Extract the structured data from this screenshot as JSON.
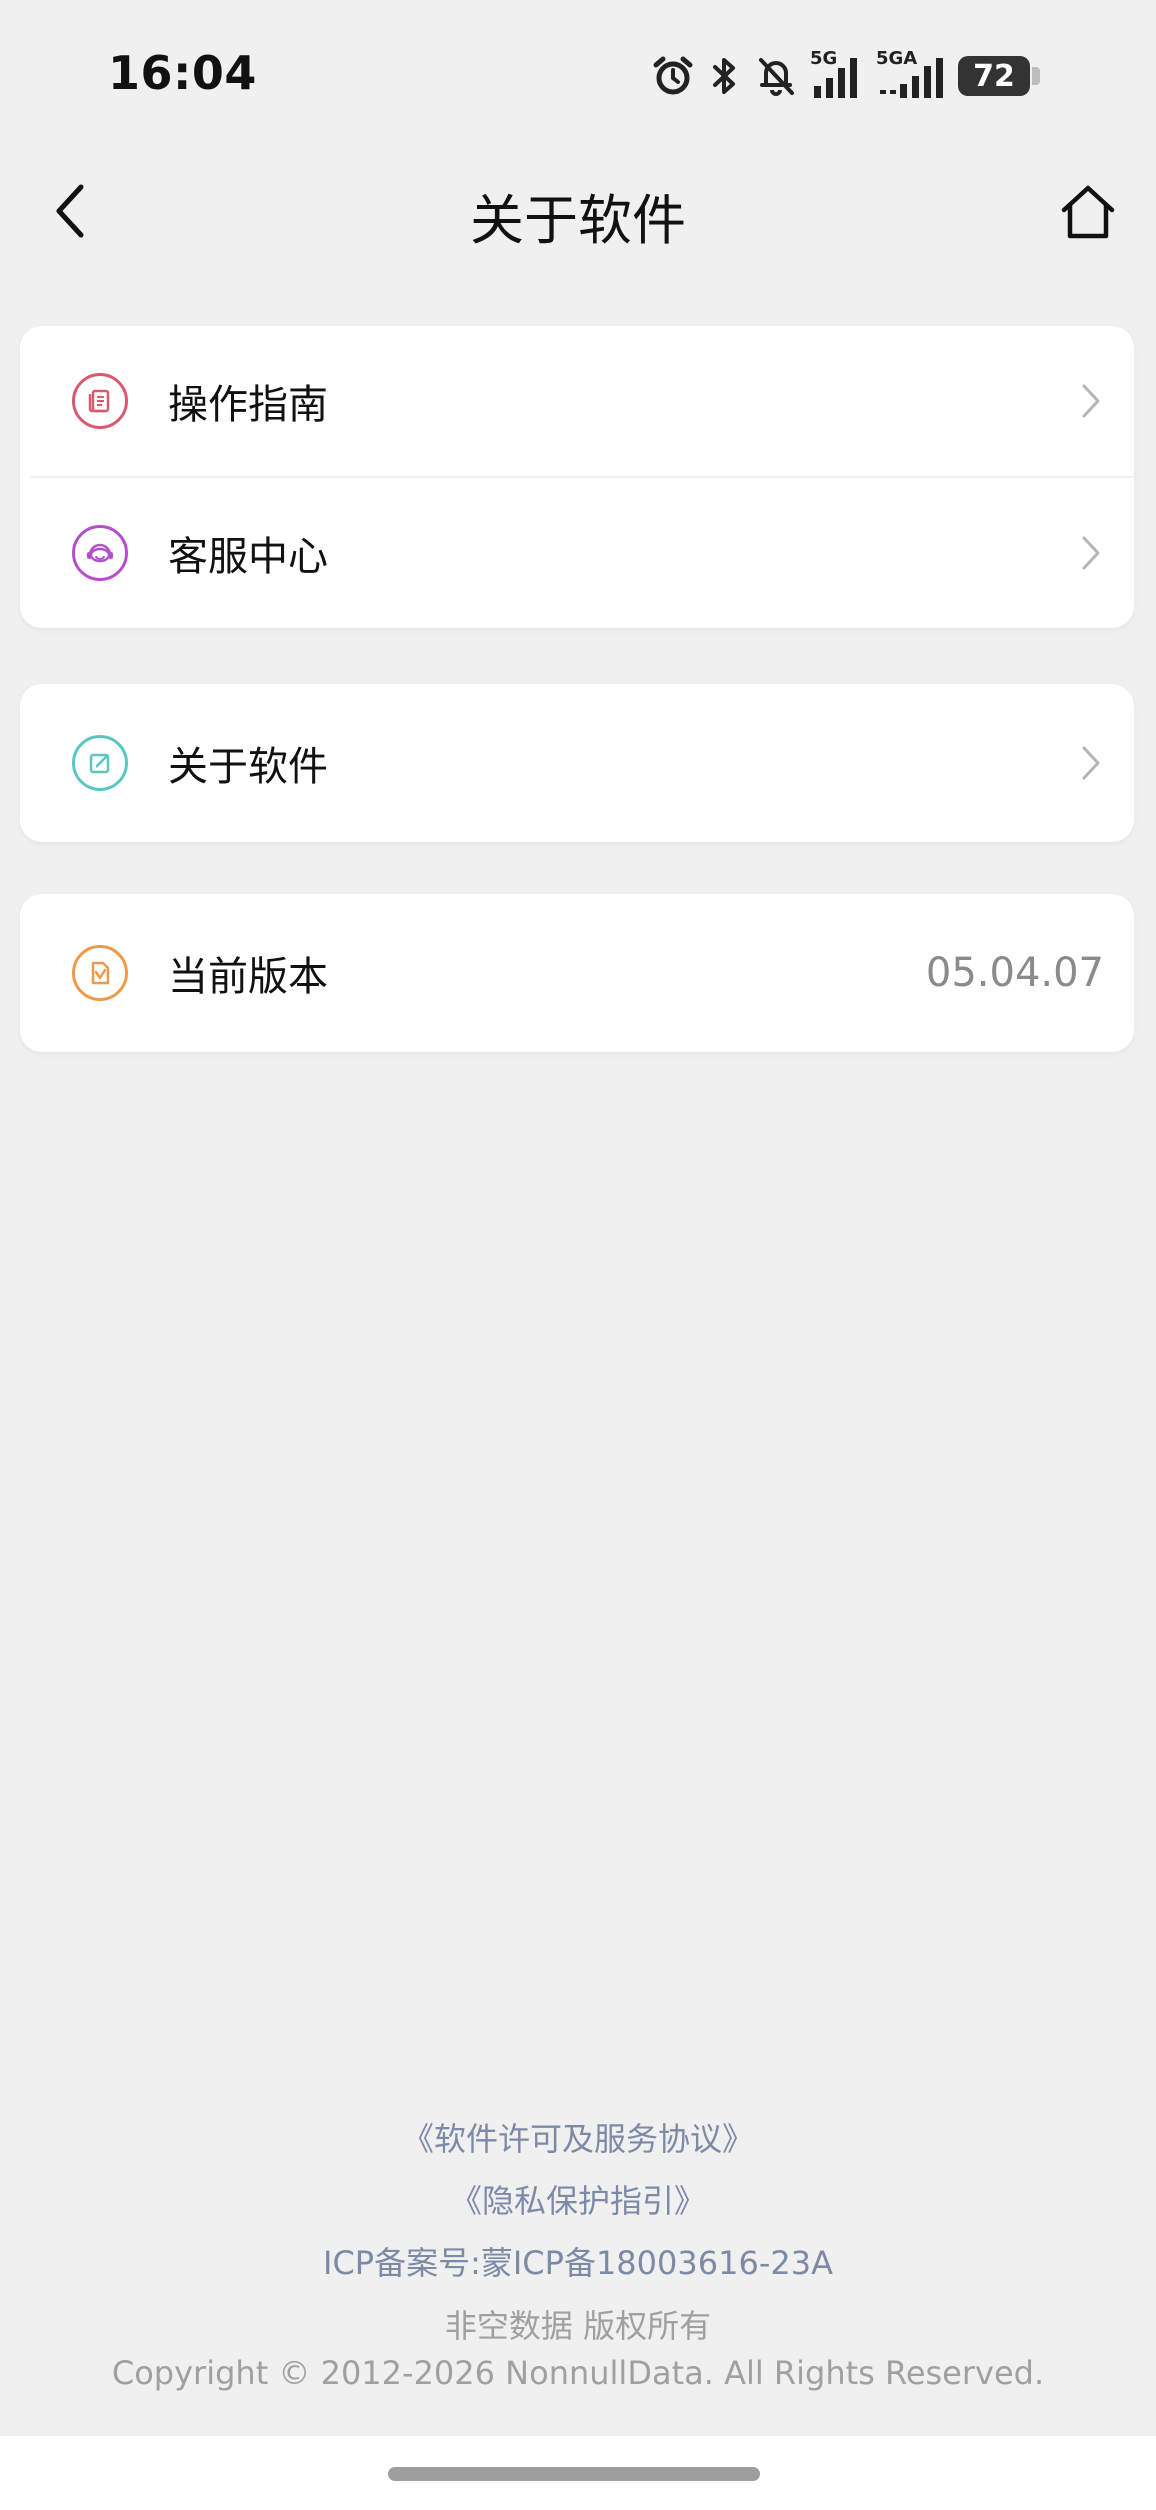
{
  "status_bar": {
    "time": "16:04",
    "network_1": "5G",
    "network_2": "5GA",
    "battery": "72"
  },
  "header": {
    "title": "关于软件"
  },
  "menu": {
    "group1": [
      {
        "label": "操作指南",
        "icon": "guide-icon",
        "color": "#d85a6e"
      },
      {
        "label": "客服中心",
        "icon": "customer-service-icon",
        "color": "#b54fcb"
      }
    ],
    "group2": [
      {
        "label": "关于软件",
        "icon": "edit-icon",
        "color": "#5cc7c2"
      }
    ],
    "group3": [
      {
        "label": "当前版本",
        "icon": "version-icon",
        "color": "#ef9a4a",
        "value": "05.04.07"
      }
    ]
  },
  "footer": {
    "license_link": "《软件许可及服务协议》",
    "privacy_link": "《隐私保护指引》",
    "icp": "ICP备案号:蒙ICP备18003616-23A",
    "copyright_cn": "非空数据 版权所有",
    "copyright_en": "Copyright © 2012-2026 NonnullData. All Rights Reserved."
  }
}
